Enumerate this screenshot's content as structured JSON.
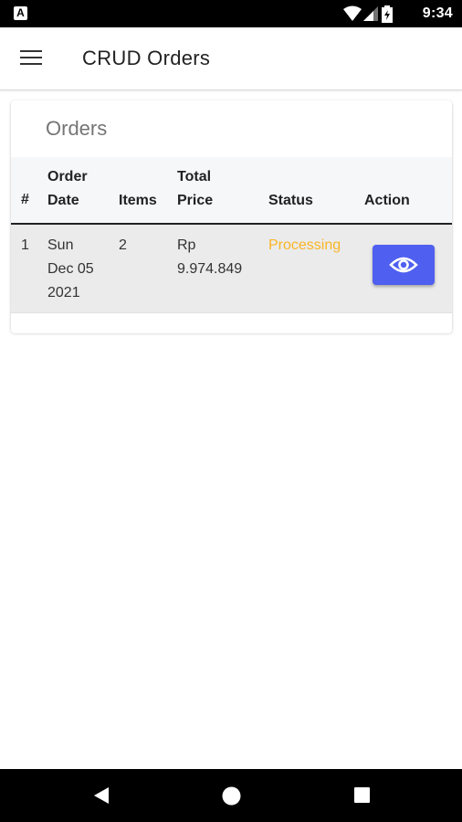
{
  "status_bar": {
    "left_icon": "A",
    "time": "9:34",
    "icons": [
      "wifi-icon",
      "signal-icon",
      "battery-icon"
    ]
  },
  "app_bar": {
    "title": "CRUD Orders",
    "menu_icon": "hamburger-menu-icon"
  },
  "card": {
    "title": "Orders",
    "columns": {
      "index": "#",
      "order_date_1": "Order",
      "order_date_2": "Date",
      "items": "Items",
      "total_price_1": "Total",
      "total_price_2": "Price",
      "status": "Status",
      "action": "Action"
    },
    "rows": [
      {
        "index": "1",
        "date_day": "Sun",
        "date_monthday": "Dec 05",
        "date_year": "2021",
        "items": "2",
        "price_currency": "Rp",
        "price_value": "9.974.849",
        "status": "Processing",
        "action_icon": "eye-icon"
      }
    ]
  },
  "colors": {
    "accent_button": "#4f5ff0",
    "status_processing": "#f9b526",
    "header_bg": "#f5f7f9",
    "row_bg": "#ebebeb"
  },
  "nav_bar": {
    "icons": [
      "back-triangle-icon",
      "home-circle-icon",
      "recents-square-icon"
    ]
  }
}
